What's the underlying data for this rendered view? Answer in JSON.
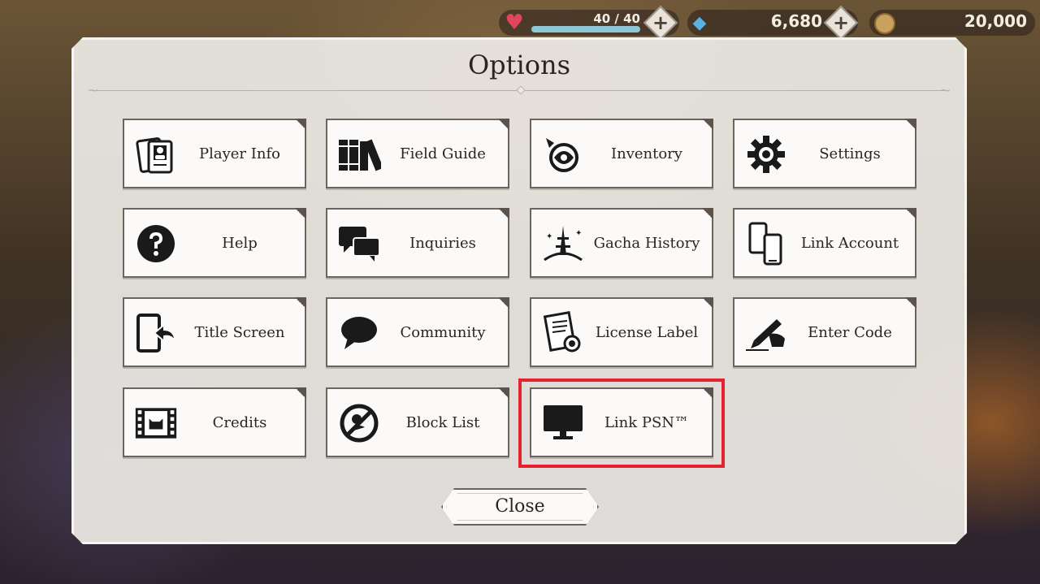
{
  "status": {
    "hp": "40 / 40",
    "hp_fraction": 1.0,
    "gems": "6,680",
    "coins": "20,000"
  },
  "dialog": {
    "title": "Options",
    "close_label": "Close"
  },
  "buttons": {
    "player_info": "Player Info",
    "field_guide": "Field Guide",
    "inventory": "Inventory",
    "settings": "Settings",
    "help": "Help",
    "inquiries": "Inquiries",
    "gacha_history": "Gacha History",
    "link_account": "Link Account",
    "title_screen": "Title Screen",
    "community": "Community",
    "license_label": "License Label",
    "enter_code": "Enter Code",
    "credits": "Credits",
    "block_list": "Block List",
    "link_psn": "Link PSN™"
  },
  "icons": {
    "player_info": "id-card-icon",
    "field_guide": "books-icon",
    "inventory": "ornament-icon",
    "settings": "gear-icon",
    "help": "question-icon",
    "inquiries": "chat-bubbles-icon",
    "gacha_history": "tower-icon",
    "link_account": "phones-icon",
    "title_screen": "exit-icon",
    "community": "speech-bubble-icon",
    "license_label": "certificate-icon",
    "enter_code": "pen-icon",
    "credits": "film-icon",
    "block_list": "block-icon",
    "link_psn": "monitor-icon"
  },
  "colors": {
    "highlight": "#e5232e",
    "hp_bar": "#8fc7d6",
    "heart": "#e0455a"
  }
}
